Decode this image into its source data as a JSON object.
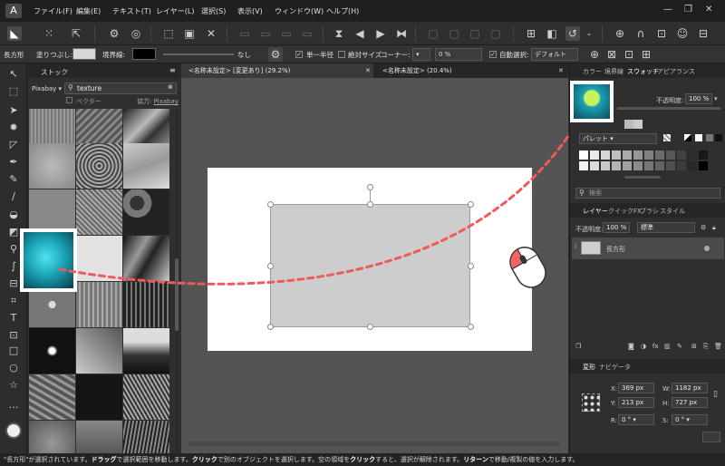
{
  "menu": [
    "ファイル(F)",
    "編集(E)",
    "テキスト(T)",
    "レイヤー(L)",
    "選択(S)",
    "表示(V)",
    "ウィンドウ(W)",
    "ヘルプ(H)"
  ],
  "window_controls": [
    "—",
    "❐",
    "✕"
  ],
  "context": {
    "shape_label": "長方形",
    "fill_label": "塗りつぶし:",
    "stroke_label": "境界線:",
    "stroke_value": "なし",
    "single_label": "単一半径",
    "absolute_label": "絶対サイズ",
    "corner_label": "コーナー:",
    "corner_value": "0 %",
    "autoselect_label": "自動選択:",
    "autoselect_value": "デフォルト",
    "fill_color": "#d8d8d8",
    "stroke_color": "#000000"
  },
  "stock": {
    "title": "ストック",
    "source": "Pixabay",
    "search_value": "texture",
    "vector_label": "ベクター",
    "credit_prefix": "協力:",
    "credit_link": "Pixabay"
  },
  "tabs": [
    {
      "label": "<名称未設定> [変更あり] (29.2%)"
    },
    {
      "label": "<名称未設定> (20.4%)"
    }
  ],
  "right": {
    "top_tabs": [
      "カラー",
      "境界線",
      "スウォッチ",
      "アピアランス"
    ],
    "opacity_label": "不透明度:",
    "opacity_value": "100 %",
    "palette_value": "パレット",
    "search_placeholder": "検索",
    "layer_tabs": [
      "レイヤー",
      "クイックFX",
      "ブラシ",
      "スタイル"
    ],
    "layer_opacity_label": "不透明度:",
    "layer_opacity_value": "100 %",
    "blend_value": "標準",
    "layer_name": "長方形",
    "transform_tabs": [
      "変形",
      "ナビゲータ"
    ],
    "x_label": "X:",
    "x_value": "369 px",
    "y_label": "Y:",
    "y_value": "213 px",
    "w_label": "W:",
    "w_value": "1182 px",
    "h_label": "H:",
    "h_value": "727 px",
    "r_label": "R:",
    "r_value": "0 °",
    "s_label": "S:",
    "s_value": "0 °"
  },
  "status": {
    "p1": "\"長方形\"が選択されています。",
    "b1": "ドラッグ",
    "p2": "で選択範囲を移動します。",
    "b2": "クリック",
    "p3": "で別のオブジェクトを選択します。空の領域を",
    "b3": "クリック",
    "p4": "すると、選択が解除されます。",
    "b4": "リターン",
    "p5": "で移動/複製の値を入力します。"
  },
  "colors": {
    "arrow": "#f05a5a",
    "highlight": "#ffffff",
    "teal": "#1aa3b5"
  }
}
